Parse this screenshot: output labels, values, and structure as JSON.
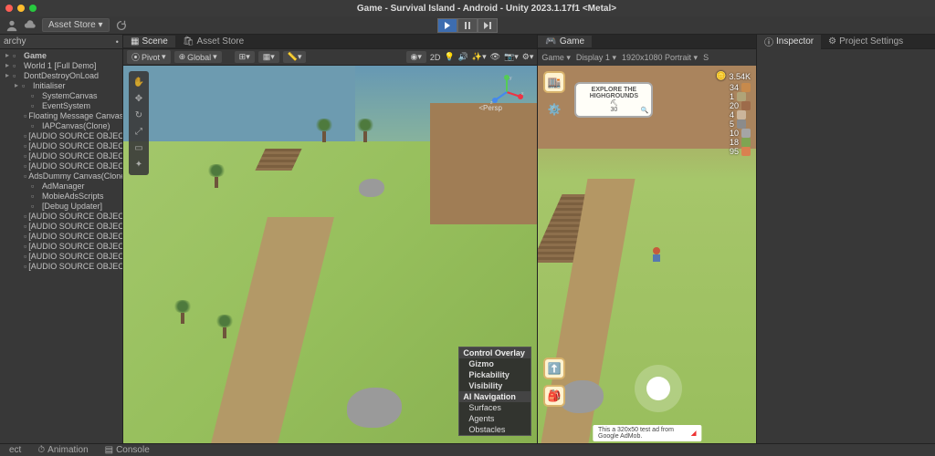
{
  "title": "Game - Survival Island - Android - Unity 2023.1.17f1 <Metal>",
  "toolbar": {
    "assetStore": "Asset Store"
  },
  "hierarchy": {
    "header": "archy",
    "items": [
      {
        "label": "Game",
        "depth": 1,
        "bold": true
      },
      {
        "label": "World 1 [Full Demo]",
        "depth": 1
      },
      {
        "label": "DontDestroyOnLoad",
        "depth": 1
      },
      {
        "label": "Initialiser",
        "depth": 2
      },
      {
        "label": "SystemCanvas",
        "depth": 3
      },
      {
        "label": "EventSystem",
        "depth": 3
      },
      {
        "label": "Floating Message Canvas(C",
        "depth": 3
      },
      {
        "label": "IAPCanvas(Clone)",
        "depth": 3
      },
      {
        "label": "[AUDIO SOURCE OBJECT]",
        "depth": 3
      },
      {
        "label": "[AUDIO SOURCE OBJECT]",
        "depth": 3
      },
      {
        "label": "[AUDIO SOURCE OBJECT]",
        "depth": 3
      },
      {
        "label": "[AUDIO SOURCE OBJECT]",
        "depth": 3
      },
      {
        "label": "AdsDummy Canvas(Clone)",
        "depth": 3
      },
      {
        "label": "AdManager",
        "depth": 3
      },
      {
        "label": "MobieAdsScripts",
        "depth": 3
      },
      {
        "label": "[Debug Updater]",
        "depth": 3
      },
      {
        "label": "[AUDIO SOURCE OBJECT]",
        "depth": 3
      },
      {
        "label": "[AUDIO SOURCE OBJECT]",
        "depth": 3
      },
      {
        "label": "[AUDIO SOURCE OBJECT]",
        "depth": 3
      },
      {
        "label": "[AUDIO SOURCE OBJECT]",
        "depth": 3
      },
      {
        "label": "[AUDIO SOURCE OBJECT]",
        "depth": 3
      },
      {
        "label": "[AUDIO SOURCE OBJECT]",
        "depth": 3
      }
    ]
  },
  "sceneTabs": {
    "scene": "Scene",
    "assetStore": "Asset Store"
  },
  "sceneToolbar": {
    "pivot": "Pivot",
    "global": "Global",
    "twoD": "2D"
  },
  "gizmoAxes": {
    "x": "x",
    "y": "y",
    "z": "z"
  },
  "perspLabel": "<Persp",
  "controlOverlay": {
    "header": "Control Overlay",
    "gizmo": "Gizmo",
    "pickability": "Pickability",
    "visibility": "Visibility",
    "aiNav": "AI Navigation",
    "surfaces": "Surfaces",
    "agents": "Agents",
    "obstacles": "Obstacles"
  },
  "gameTabs": {
    "game": "Game"
  },
  "gameToolbar": {
    "game": "Game",
    "display": "Display 1",
    "resolution": "1920x1080 Portrait",
    "scale": "S"
  },
  "hud": {
    "coins": "3.54K",
    "resources": [
      {
        "value": "34",
        "color": "#c78a4c"
      },
      {
        "value": "1",
        "color": "#b0a478"
      },
      {
        "value": "20",
        "color": "#9d6b4a"
      },
      {
        "value": "4",
        "color": "#cbb59b"
      },
      {
        "value": "5",
        "color": "#8b8b8b"
      },
      {
        "value": "10",
        "color": "#a5a5a5"
      },
      {
        "value": "18",
        "color": "#7fa452"
      },
      {
        "value": "95",
        "color": "#d98050"
      }
    ],
    "quest": {
      "title": "EXPLORE THE HIGHGROUNDS",
      "progress": "30"
    },
    "ad": "This a 320x50 test ad from Google AdMob."
  },
  "inspector": {
    "tab1": "Inspector",
    "tab2": "Project Settings"
  },
  "footer": {
    "ect": "ect",
    "animation": "Animation",
    "console": "Console"
  }
}
